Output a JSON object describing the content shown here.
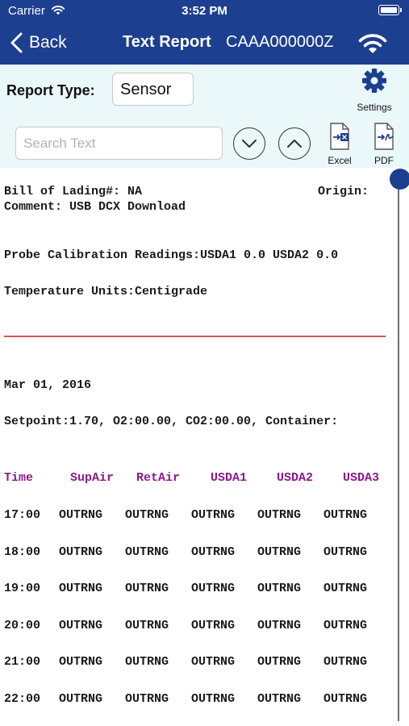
{
  "status_bar": {
    "carrier": "Carrier",
    "time": "3:52 PM"
  },
  "nav": {
    "back_label": "Back",
    "title": "Text Report",
    "serial": "CAAA000000Z"
  },
  "controls": {
    "report_type_label": "Report Type:",
    "report_type_value": "Sensor",
    "settings_label": "Settings",
    "search_placeholder": "Search Text",
    "search_value": "",
    "excel_label": "Excel",
    "pdf_label": "PDF"
  },
  "report": {
    "bill_of_lading": "Bill of Lading#: NA",
    "origin": "Origin: ",
    "comment": "Comment: USB DCX Download",
    "probe_calibration": "Probe Calibration Readings:USDA1 0.0 USDA2 0.0",
    "temperature_units": "Temperature Units:Centigrade",
    "date": "Mar 01, 2016",
    "setpoint": "Setpoint:1.70, O2:00.00, CO2:00.00, Container:",
    "columns": [
      "Time",
      "SupAir",
      "RetAir",
      "USDA1",
      "USDA2",
      "USDA3"
    ],
    "rows": [
      [
        "17:00",
        "OUTRNG",
        "OUTRNG",
        "OUTRNG",
        "OUTRNG",
        "OUTRNG"
      ],
      [
        "18:00",
        "OUTRNG",
        "OUTRNG",
        "OUTRNG",
        "OUTRNG",
        "OUTRNG"
      ],
      [
        "19:00",
        "OUTRNG",
        "OUTRNG",
        "OUTRNG",
        "OUTRNG",
        "OUTRNG"
      ],
      [
        "20:00",
        "OUTRNG",
        "OUTRNG",
        "OUTRNG",
        "OUTRNG",
        "OUTRNG"
      ],
      [
        "21:00",
        "OUTRNG",
        "OUTRNG",
        "OUTRNG",
        "OUTRNG",
        "OUTRNG"
      ],
      [
        "22:00",
        "OUTRNG",
        "OUTRNG",
        "OUTRNG",
        "OUTRNG",
        "OUTRNG"
      ]
    ]
  },
  "colors": {
    "nav_blue": "#1d3f8f",
    "controls_bg": "#eaf8fa",
    "header_purple": "#8b1a8b",
    "rule_red": "#d9534f"
  },
  "icons": [
    "wifi-icon",
    "battery-icon",
    "back-chevron-icon",
    "gear-icon",
    "chevron-down-icon",
    "chevron-up-icon",
    "excel-export-icon",
    "pdf-export-icon"
  ]
}
